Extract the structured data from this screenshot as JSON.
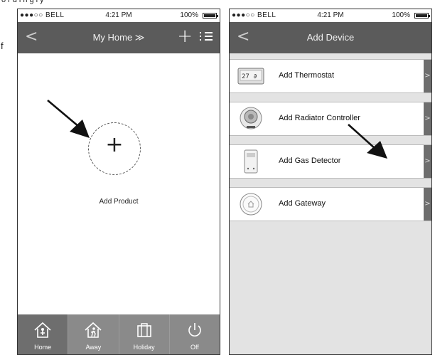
{
  "document": {
    "top_text": "ordingly",
    "side_text": "f"
  },
  "status_bar": {
    "carrier": "●●●○○ BELL",
    "time": "4:21 PM",
    "battery": "100%"
  },
  "home_screen": {
    "title": "My Home ≫",
    "back_glyph": "<",
    "add_glyph": "+",
    "add_product_label": "Add Product",
    "plus_glyph": "+",
    "tabs": [
      {
        "label": "Home",
        "icon": "home-icon",
        "active": true
      },
      {
        "label": "Away",
        "icon": "away-icon",
        "active": false
      },
      {
        "label": "Holiday",
        "icon": "holiday-icon",
        "active": false
      },
      {
        "label": "Off",
        "icon": "power-icon",
        "active": false
      }
    ]
  },
  "add_device_screen": {
    "title": "Add Device",
    "back_glyph": "<",
    "devices": [
      {
        "label": "Add Thermostat",
        "icon": "thermostat-icon"
      },
      {
        "label": "Add Radiator Controller",
        "icon": "radiator-controller-icon"
      },
      {
        "label": "Add Gas Detector",
        "icon": "gas-detector-icon"
      },
      {
        "label": "Add Gateway",
        "icon": "gateway-icon"
      }
    ],
    "chevron": ">"
  },
  "colors": {
    "navbar": "#5b5b5b",
    "tabbar": "#8a8a8a",
    "list_background": "#e3e3e3"
  }
}
